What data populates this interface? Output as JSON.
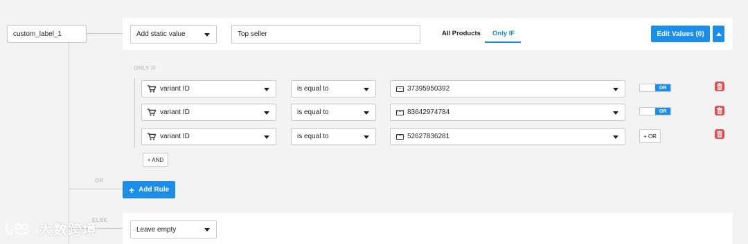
{
  "custom_label": "custom_label_1",
  "header": {
    "source_select": "Add static value",
    "static_value": "Top seller",
    "tabs": [
      {
        "label": "All Products",
        "active": false
      },
      {
        "label": "Only IF",
        "active": true
      }
    ],
    "edit_values_label": "Edit Values (0)"
  },
  "only_if_label": "ONLY IF",
  "conditions": [
    {
      "field": "variant ID",
      "operator": "is equal to",
      "value": "37395950392",
      "action": "OR",
      "action_type": "toggle"
    },
    {
      "field": "variant ID",
      "operator": "is equal to",
      "value": "83642974784",
      "action": "OR",
      "action_type": "toggle"
    },
    {
      "field": "variant ID",
      "operator": "is equal to",
      "value": "52627836281",
      "action": "+ OR",
      "action_type": "button"
    }
  ],
  "and_button": "+ AND",
  "or_label": "OR",
  "add_rule_label": "Add Rule",
  "else_label": "ELSE",
  "else_select": "Leave empty",
  "watermark": "大数跨境",
  "colors": {
    "accent": "#1a8ee8",
    "danger": "#e84c4c",
    "background": "#f3f3f3"
  }
}
